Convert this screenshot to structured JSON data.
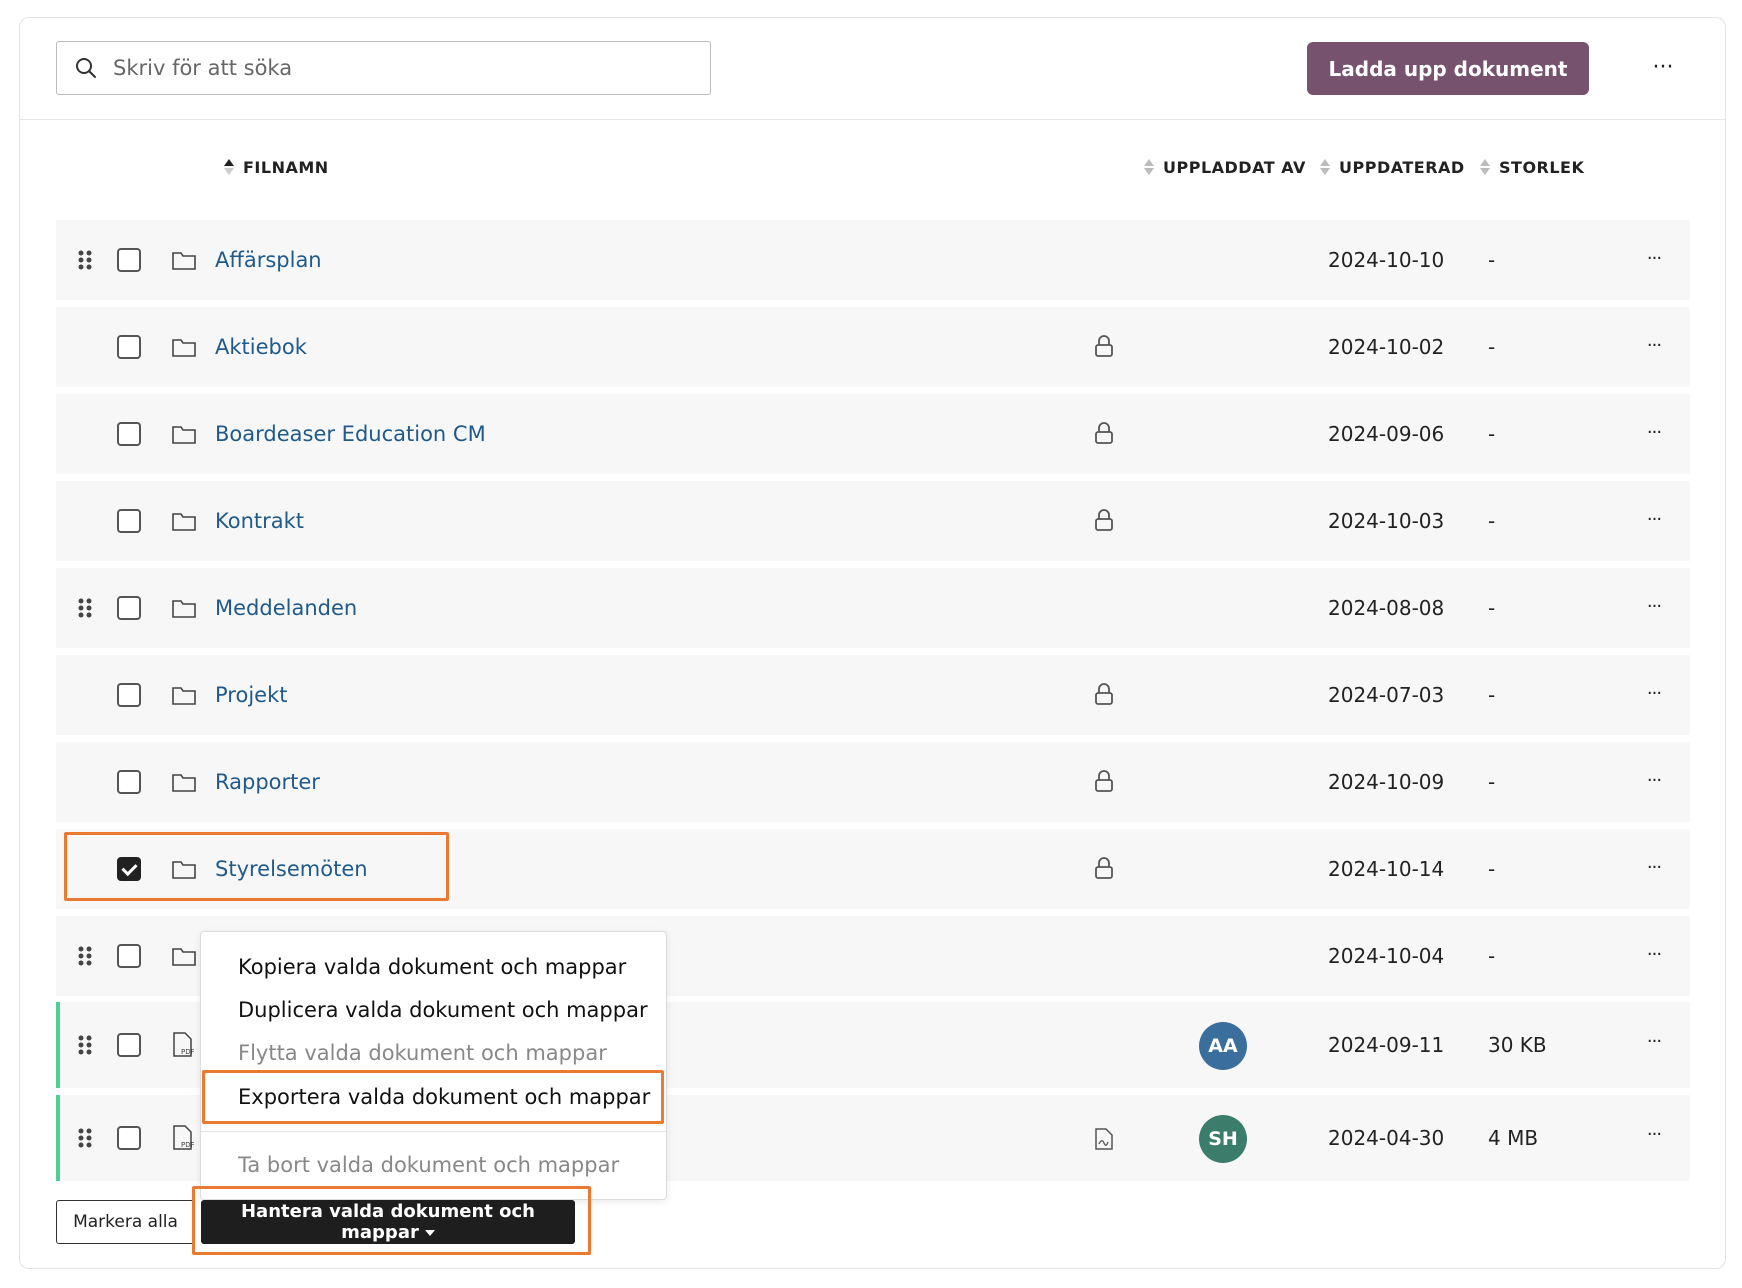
{
  "search": {
    "placeholder": "Skriv för att söka"
  },
  "toolbar": {
    "upload_label": "Ladda upp dokument",
    "more_label": "···"
  },
  "columns": {
    "filename": "FILNAMN",
    "uploaded_by": "UPPLADDAT AV",
    "updated": "UPPDATERAD",
    "size": "STORLEK"
  },
  "rows": [
    {
      "name": "Affärsplan",
      "date": "2024-10-10",
      "size": "-",
      "locked": false,
      "drag": true,
      "checked": false
    },
    {
      "name": "Aktiebok",
      "date": "2024-10-02",
      "size": "-",
      "locked": true,
      "drag": false,
      "checked": false
    },
    {
      "name": "Boardeaser Education CM",
      "date": "2024-09-06",
      "size": "-",
      "locked": true,
      "drag": false,
      "checked": false
    },
    {
      "name": "Kontrakt",
      "date": "2024-10-03",
      "size": "-",
      "locked": true,
      "drag": false,
      "checked": false
    },
    {
      "name": "Meddelanden",
      "date": "2024-08-08",
      "size": "-",
      "locked": false,
      "drag": true,
      "checked": false
    },
    {
      "name": "Projekt",
      "date": "2024-07-03",
      "size": "-",
      "locked": true,
      "drag": false,
      "checked": false
    },
    {
      "name": "Rapporter",
      "date": "2024-10-09",
      "size": "-",
      "locked": true,
      "drag": false,
      "checked": false
    },
    {
      "name": "Styrelsemöten",
      "date": "2024-10-14",
      "size": "-",
      "locked": true,
      "drag": false,
      "checked": true
    },
    {
      "name": "",
      "date": "2024-10-04",
      "size": "-",
      "locked": false,
      "drag": true,
      "checked": false
    },
    {
      "name": "",
      "date": "2024-09-11",
      "size": "30 KB",
      "avatar": "AA",
      "avatar_color": "#3a6e9c",
      "drag": true,
      "checked": false
    },
    {
      "name": "",
      "date": "2024-04-30",
      "size": "4 MB",
      "avatar": "SH",
      "avatar_color": "#3a7d6a",
      "drag": true,
      "checked": false
    }
  ],
  "menu": {
    "copy": "Kopiera valda dokument och mappar",
    "duplicate": "Duplicera valda dokument och mappar",
    "move": "Flytta valda dokument och mappar",
    "export": "Exportera valda dokument och mappar",
    "delete": "Ta bort valda dokument och mappar"
  },
  "footer": {
    "select_all": "Markera alla",
    "manage": "Hantera valda dokument och mappar"
  },
  "colors": {
    "brand": "#76526f",
    "link": "#1f5a8a",
    "highlight": "#ea7a31",
    "doc_accent": "#4ecf97"
  }
}
